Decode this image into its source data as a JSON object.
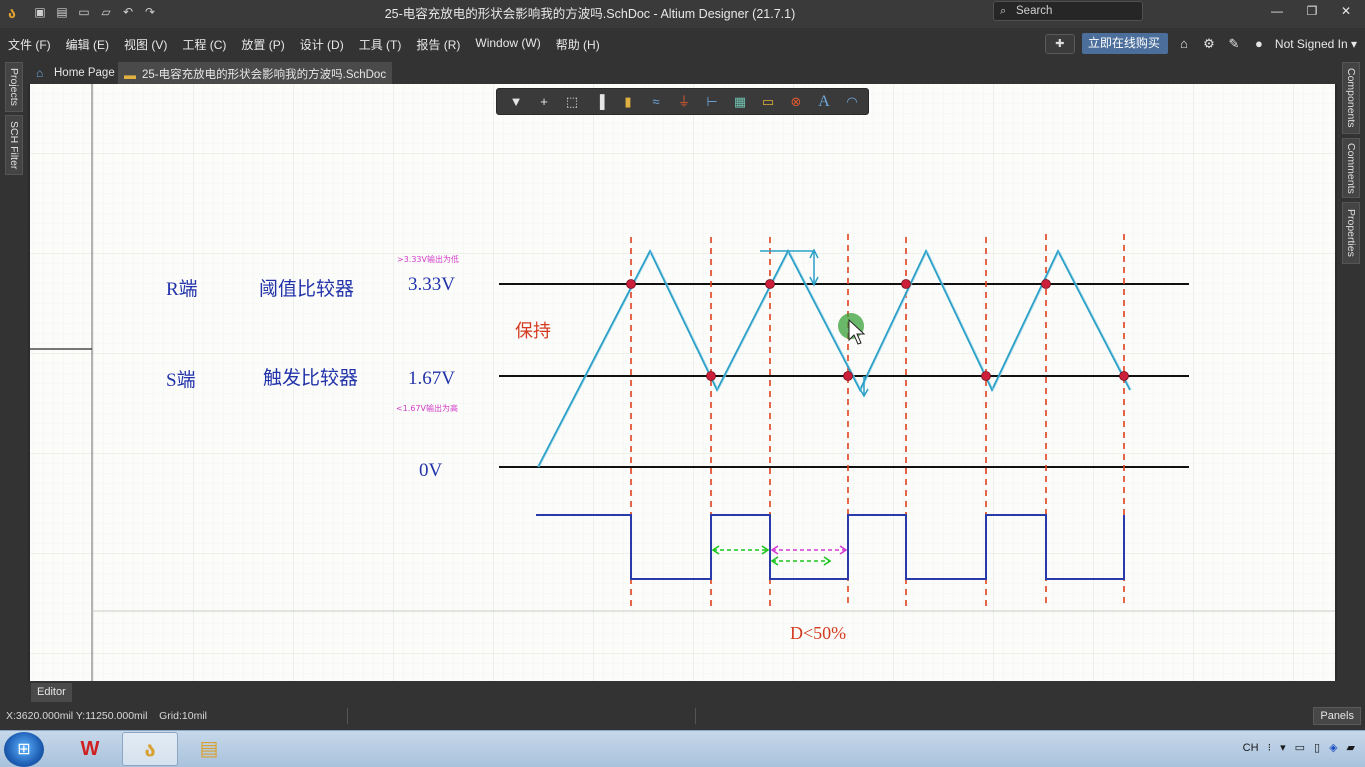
{
  "window": {
    "title": "25-电容充放电的形状会影响我的方波吗.SchDoc - Altium Designer (21.7.1)",
    "search_placeholder": "Search",
    "minimize_icon": "minimize-icon",
    "maximize_icon": "restore-icon",
    "close_icon": "close-icon"
  },
  "menubar": {
    "items": [
      "文件 (F)",
      "编辑 (E)",
      "视图 (V)",
      "工程 (C)",
      "放置 (P)",
      "设计 (D)",
      "工具 (T)",
      "报告 (R)",
      "Window (W)",
      "帮助 (H)"
    ],
    "buy_label": "立即在线购买",
    "user_label": "Not Signed In"
  },
  "left_panel": {
    "tabs": [
      "Projects",
      "SCH Filter"
    ]
  },
  "right_panel": {
    "tabs": [
      "Components",
      "Comments",
      "Properties"
    ]
  },
  "doc_tabs": [
    {
      "label": "Home Page",
      "icon": "home-icon"
    },
    {
      "label": "25-电容充放电的形状会影响我的方波吗.SchDoc",
      "icon": "schematic-doc-icon"
    }
  ],
  "schematic": {
    "label_r_terminal": "R端",
    "label_threshold": "阈值比较器",
    "label_v_high": "3.33V",
    "note_high": ">3.33V输出为低",
    "label_hold": "保持",
    "label_s_terminal": "S端",
    "label_trigger": "触发比较器",
    "label_v_low": "1.67V",
    "note_low": "<1.67V输出为高",
    "label_zero": "0V",
    "label_duty": "D<50%",
    "colors": {
      "blue_text": "#2233aa",
      "red_text": "#d43a20",
      "magenta_note": "#d23cc8",
      "triangle_wave": "#2aa0c8",
      "square_wave": "#2a3aa8",
      "marker": "#cc1f3a",
      "dashed_green": "#1cc41c",
      "dashed_magenta": "#d43ad4"
    }
  },
  "editor_tab": "Editor",
  "status": {
    "coords": "X:3620.000mil Y:11250.000mil",
    "grid": "Grid:10mil",
    "panels_label": "Panels"
  },
  "taskbar": {
    "tray_lang": "CH"
  }
}
